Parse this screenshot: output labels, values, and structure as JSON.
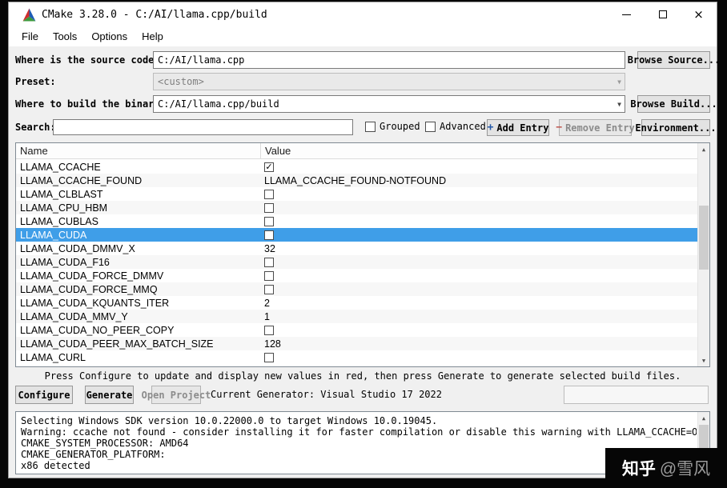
{
  "window": {
    "title": "CMake 3.28.0 - C:/AI/llama.cpp/build"
  },
  "menu": {
    "items": [
      "File",
      "Tools",
      "Options",
      "Help"
    ]
  },
  "form": {
    "source_label": "Where is the source code:",
    "source_value": "C:/AI/llama.cpp",
    "browse_source_label": "Browse Source...",
    "preset_label": "Preset:",
    "preset_value": "<custom>",
    "build_label": "Where to build the binaries:",
    "build_value": "C:/AI/llama.cpp/build",
    "browse_build_label": "Browse Build..."
  },
  "search": {
    "label": "Search:",
    "value": "",
    "grouped_label": "Grouped",
    "advanced_label": "Advanced",
    "add_entry_label": "Add Entry",
    "remove_entry_label": "Remove Entry",
    "environment_label": "Environment..."
  },
  "table": {
    "columns": [
      "Name",
      "Value"
    ],
    "rows": [
      {
        "name": "LLAMA_CCACHE",
        "type": "checkbox",
        "checked": true,
        "selected": false
      },
      {
        "name": "LLAMA_CCACHE_FOUND",
        "type": "text",
        "value": "LLAMA_CCACHE_FOUND-NOTFOUND",
        "selected": false
      },
      {
        "name": "LLAMA_CLBLAST",
        "type": "checkbox",
        "checked": false,
        "selected": false
      },
      {
        "name": "LLAMA_CPU_HBM",
        "type": "checkbox",
        "checked": false,
        "selected": false
      },
      {
        "name": "LLAMA_CUBLAS",
        "type": "checkbox",
        "checked": false,
        "selected": false
      },
      {
        "name": "LLAMA_CUDA",
        "type": "checkbox",
        "checked": false,
        "selected": true
      },
      {
        "name": "LLAMA_CUDA_DMMV_X",
        "type": "text",
        "value": "32",
        "selected": false
      },
      {
        "name": "LLAMA_CUDA_F16",
        "type": "checkbox",
        "checked": false,
        "selected": false
      },
      {
        "name": "LLAMA_CUDA_FORCE_DMMV",
        "type": "checkbox",
        "checked": false,
        "selected": false
      },
      {
        "name": "LLAMA_CUDA_FORCE_MMQ",
        "type": "checkbox",
        "checked": false,
        "selected": false
      },
      {
        "name": "LLAMA_CUDA_KQUANTS_ITER",
        "type": "text",
        "value": "2",
        "selected": false
      },
      {
        "name": "LLAMA_CUDA_MMV_Y",
        "type": "text",
        "value": "1",
        "selected": false
      },
      {
        "name": "LLAMA_CUDA_NO_PEER_COPY",
        "type": "checkbox",
        "checked": false,
        "selected": false
      },
      {
        "name": "LLAMA_CUDA_PEER_MAX_BATCH_SIZE",
        "type": "text",
        "value": "128",
        "selected": false
      },
      {
        "name": "LLAMA_CURL",
        "type": "checkbox",
        "checked": false,
        "selected": false
      }
    ]
  },
  "hint": "Press Configure to update and display new values in red, then press Generate to generate selected build files.",
  "actions": {
    "configure_label": "Configure",
    "generate_label": "Generate",
    "open_project_label": "Open Project",
    "current_generator": "Current Generator: Visual Studio 17 2022"
  },
  "output": {
    "lines": [
      "Selecting Windows SDK version 10.0.22000.0 to target Windows 10.0.19045.",
      "Warning: ccache not found - consider installing it for faster compilation or disable this warning with LLAMA_CCACHE=OFF",
      "CMAKE_SYSTEM_PROCESSOR: AMD64",
      "CMAKE_GENERATOR_PLATFORM:",
      "x86 detected"
    ]
  },
  "watermark": {
    "brand": "知乎",
    "handle": "@雪风"
  },
  "icons": {
    "close": "×",
    "dropdown": "▼",
    "scroll_up": "▲",
    "scroll_down": "▼",
    "add": "+",
    "remove": "−",
    "check": "✓"
  },
  "colors": {
    "selection": "#3f9ee8",
    "selection_text": "#ffffff",
    "accent": "#0078d7"
  }
}
